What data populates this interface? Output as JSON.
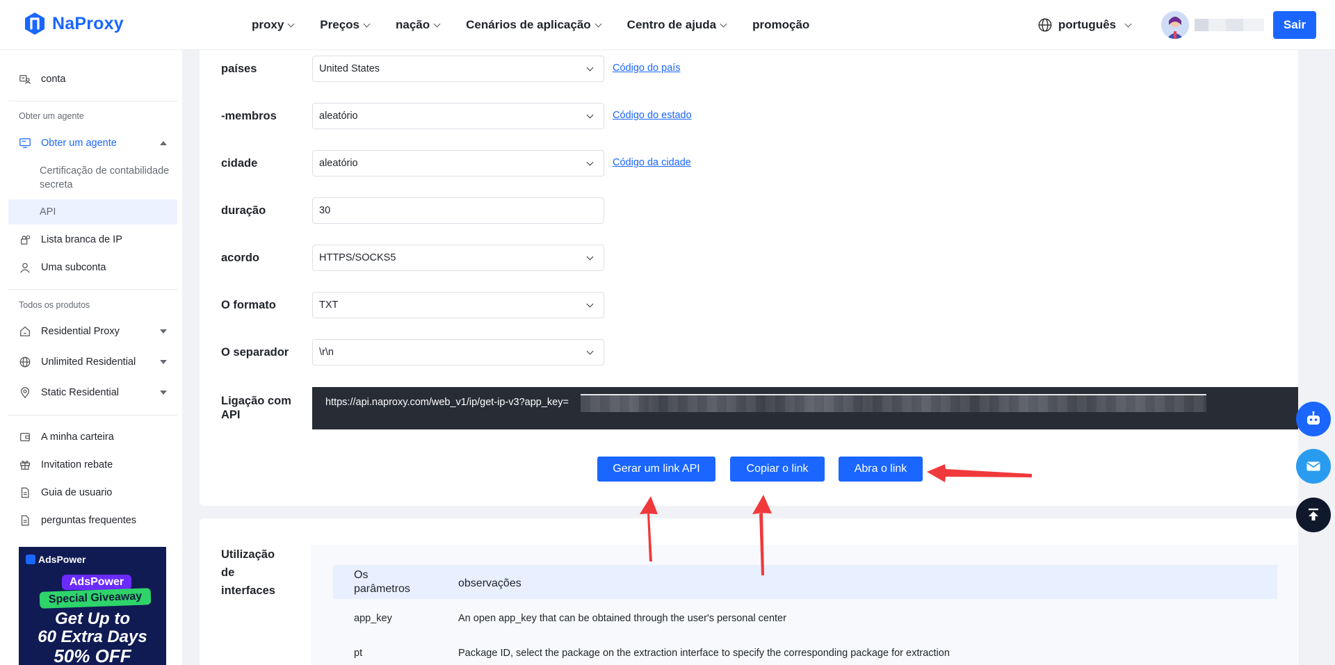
{
  "brand": {
    "name": "NaProxy"
  },
  "nav": {
    "items": [
      {
        "label": "proxy"
      },
      {
        "label": "Preços"
      },
      {
        "label": "nação"
      },
      {
        "label": "Cenários de aplicação"
      },
      {
        "label": "Centro de ajuda"
      },
      {
        "label": "promoção"
      }
    ],
    "language": "português",
    "logout": "Sair"
  },
  "sidebar": {
    "account": "conta",
    "group_agent": "Obter um agente",
    "agent": "Obter um agente",
    "sub_cert": "Certificação de contabilidade secreta",
    "sub_api": "API",
    "whitelist": "Lista branca de IP",
    "subaccount": "Uma subconta",
    "group_products": "Todos os produtos",
    "residential": "Residential Proxy",
    "unlimited": "Unlimited Residential",
    "static": "Static Residential",
    "wallet": "A minha carteira",
    "rebate": "Invitation rebate",
    "guide": "Guia de usuario",
    "faq": "perguntas frequentes"
  },
  "ad": {
    "brand": "AdsPower",
    "pill": "AdsPower",
    "giveaway": "Special Giveaway",
    "line1": "Get Up to",
    "line2": "60 Extra Days",
    "line3": "50% OFF"
  },
  "form": {
    "country": {
      "label": "países",
      "value": "United States",
      "link": "Código do país"
    },
    "state": {
      "label": "-membros",
      "value": "aleatório",
      "link": "Código do estado"
    },
    "city": {
      "label": "cidade",
      "value": "aleatório",
      "link": "Código da cidade"
    },
    "duration": {
      "label": "duração",
      "value": "30"
    },
    "protocol": {
      "label": "acordo",
      "value": "HTTPS/SOCKS5"
    },
    "format": {
      "label": "O formato",
      "value": "TXT"
    },
    "separator": {
      "label": "O separador",
      "value": "\\r\\n"
    },
    "api_link": {
      "label": "Ligação com API",
      "value": "https://api.naproxy.com/web_v1/ip/get-ip-v3?app_key="
    }
  },
  "actions": {
    "generate": "Gerar um link API",
    "copy": "Copiar o link",
    "open": "Abra o link"
  },
  "usage": {
    "label": "Utilização de interfaces",
    "columns": [
      "Os parâmetros",
      "observações"
    ],
    "rows": [
      {
        "param": "app_key",
        "note": "An open app_key that can be obtained through the user's personal center"
      },
      {
        "param": "pt",
        "note": "Package ID, select the package on the extraction interface to specify the corresponding package for extraction"
      }
    ]
  },
  "colors": {
    "primary": "#1a66ff",
    "annotation": "#f0393b",
    "code_bg": "#282c35"
  }
}
